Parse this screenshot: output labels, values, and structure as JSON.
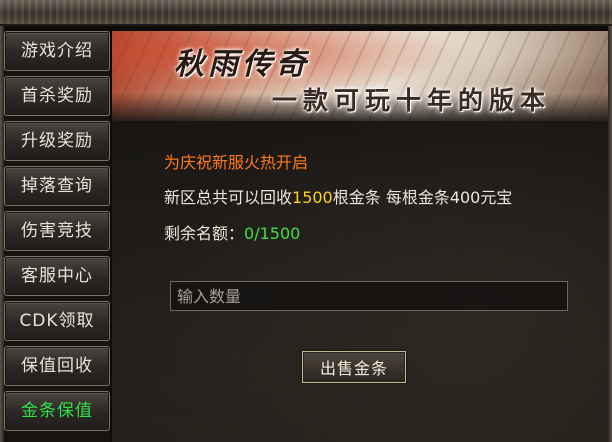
{
  "sidebar": {
    "items": [
      {
        "label": "游戏介绍"
      },
      {
        "label": "首杀奖励"
      },
      {
        "label": "升级奖励"
      },
      {
        "label": "掉落查询"
      },
      {
        "label": "伤害竞技"
      },
      {
        "label": "客服中心"
      },
      {
        "label": "CDK领取"
      },
      {
        "label": "保值回收"
      },
      {
        "label": "金条保值",
        "active": true
      }
    ]
  },
  "banner": {
    "title": "秋雨传奇",
    "slogan": "一款可玩十年的版本"
  },
  "content": {
    "announcement": "为庆祝新服火热开启",
    "recycle_text_before": "新区总共可以回收",
    "recycle_amount": "1500",
    "recycle_text_after": "根金条  每根金条400元宝",
    "remaining_label": "剩余名额：",
    "remaining_value": "0/1500",
    "quantity_placeholder": "输入数量",
    "sell_button_label": "出售金条"
  },
  "colors": {
    "accent_orange": "#ff7a1a",
    "highlight_yellow": "#ffd21e",
    "highlight_green": "#3fe03f",
    "active_menu": "#2fe04a"
  }
}
